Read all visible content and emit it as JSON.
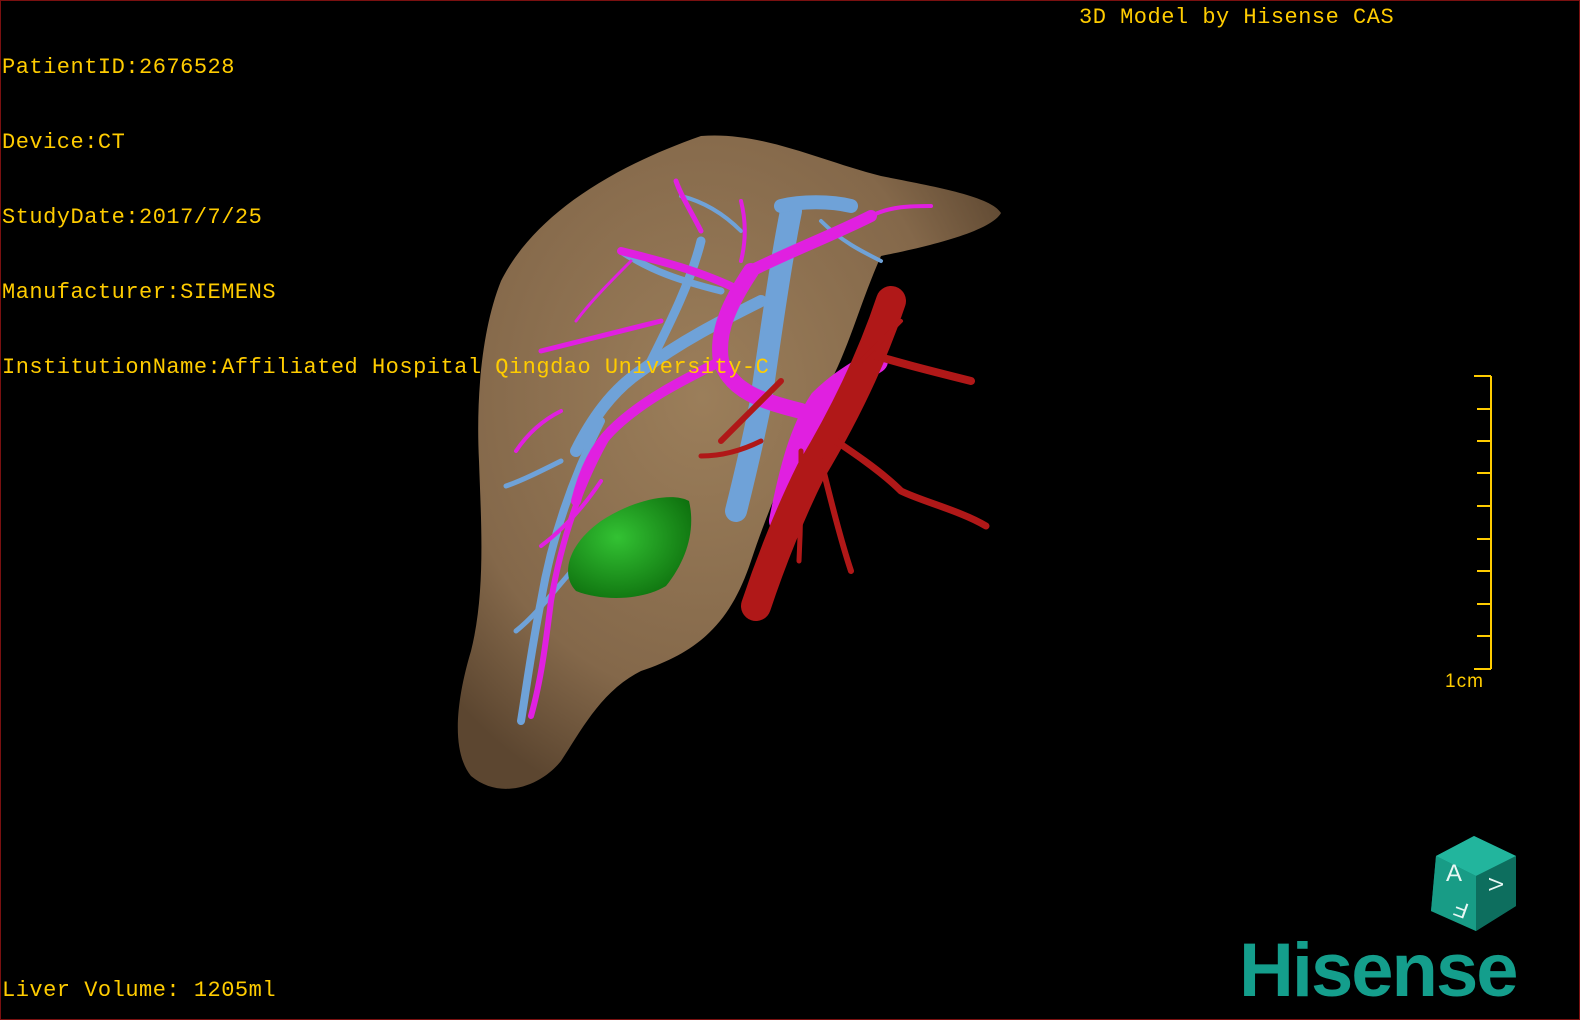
{
  "patient_info": {
    "patient_id": "PatientID:2676528",
    "device": "Device:CT",
    "study_date": "StudyDate:2017/7/25",
    "manufacturer": "Manufacturer:SIEMENS",
    "institution": "InstitutionName:Affiliated Hospital Qingdao University-C"
  },
  "header_right": "3D Model by Hisense CAS",
  "liver_volume": "Liver Volume: 1205ml",
  "scale": {
    "label": "1cm",
    "color": "#ffcc00"
  },
  "orientation_cube": {
    "face_letters": [
      "A",
      "F",
      "V"
    ],
    "color": "#1aa58f"
  },
  "brand": {
    "name": "Hisense",
    "color": "#149e8c"
  },
  "model_colors": {
    "liver": "#8b6f4e",
    "portal_vein": "#e020e0",
    "hepatic_vein": "#6fa2d8",
    "artery_ivc": "#b01818",
    "lesion": "#1aa81a"
  },
  "text_color": "#ffcc00"
}
